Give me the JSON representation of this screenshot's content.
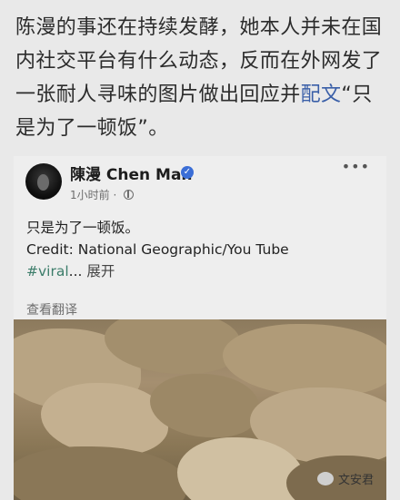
{
  "article": {
    "text_before": "陈漫的事还在持续发酵，她本人并未在国内社交平台有什么动态，反而在外网发了一张耐人寻味的图片做出回应并",
    "link": "配文",
    "text_after": "“只是为了一顿饭”。"
  },
  "post": {
    "name": "陳漫  Chen Man",
    "time": "1小时前 ·",
    "more": "•••",
    "line1": "只是为了一顿饭。",
    "line2": "Credit: National Geographic/You Tube",
    "hashtag": "#viral",
    "ellipsis": "...",
    "expand": "展开",
    "translate": "查看翻译"
  },
  "watermark": {
    "text": "文安君"
  }
}
